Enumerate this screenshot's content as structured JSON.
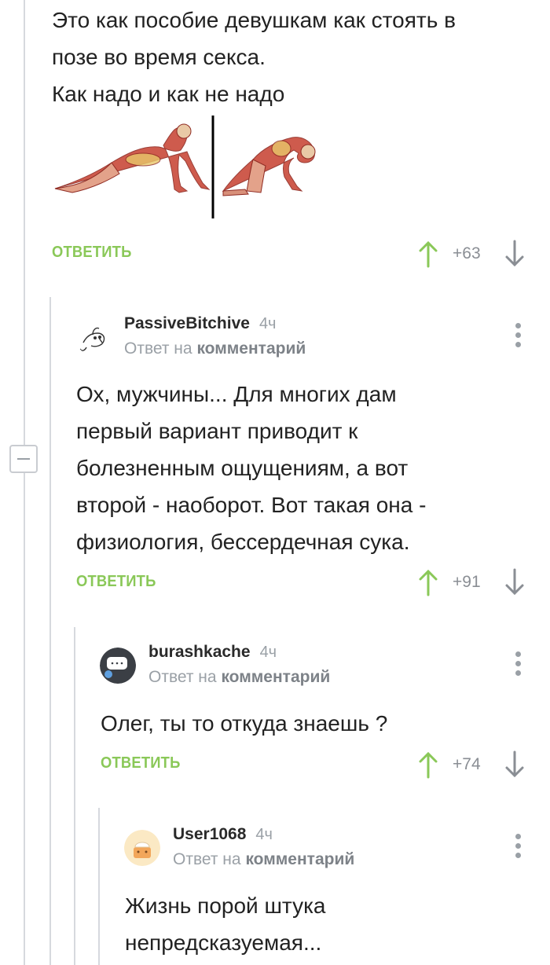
{
  "comments": [
    {
      "text_lines": [
        "Это как пособие девушкам как стоять в",
        "позе во время секса.",
        "Как надо и как не надо"
      ],
      "reply_label": "ОТВЕТИТЬ",
      "score": "+63"
    },
    {
      "username": "PassiveBitchive",
      "time": "4ч",
      "reply_prefix": "Ответ на",
      "reply_target": "комментарий",
      "text_lines": [
        "Ох, мужчины... Для многих дам",
        "первый вариант приводит к",
        "болезненным ощущениям, а вот",
        "второй - наоборот. Вот такая она -",
        "физиология, бессердечная сука."
      ],
      "reply_label": "ОТВЕТИТЬ",
      "score": "+91"
    },
    {
      "username": "burashkache",
      "time": "4ч",
      "reply_prefix": "Ответ на",
      "reply_target": "комментарий",
      "text_lines": [
        "Олег, ты то откуда знаешь ?"
      ],
      "reply_label": "ОТВЕТИТЬ",
      "score": "+74"
    },
    {
      "username": "User1068",
      "time": "4ч",
      "reply_prefix": "Ответ на",
      "reply_target": "комментарий",
      "text_lines": [
        "Жизнь порой штука",
        "непредсказуемая..."
      ]
    }
  ],
  "icons": {
    "upvote": "arrow-up-icon",
    "downvote": "arrow-down-icon",
    "more": "more-vertical-icon",
    "collapse": "minus-icon"
  },
  "colors": {
    "accent_green": "#8ac858",
    "muted_gray": "#9aa0a6",
    "thread_line": "#d6d9de",
    "muscle_red": "#c94a3a"
  }
}
